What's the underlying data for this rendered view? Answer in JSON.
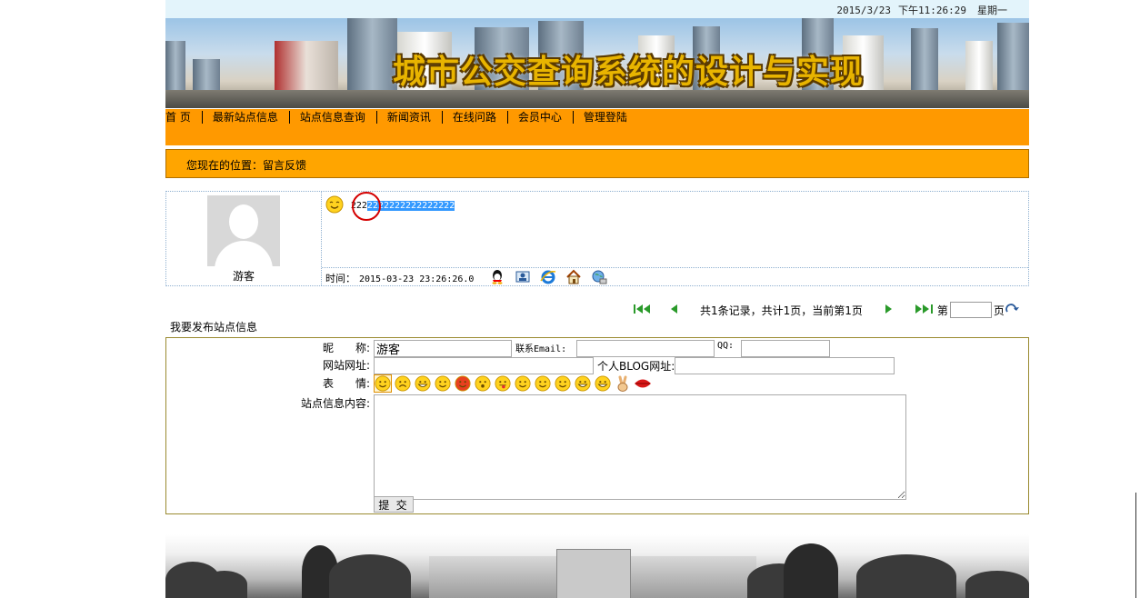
{
  "header": {
    "date": "2015/3/23",
    "time": "下午11:26:29",
    "weekday": "星期一",
    "banner_title": "城市公交查询系统的设计与实现"
  },
  "nav": {
    "items": [
      "首 页",
      "最新站点信息",
      "站点信息查询",
      "新闻资讯",
      "在线问路",
      "会员中心",
      "管理登陆"
    ]
  },
  "location": {
    "text": "您现在的位置：留言反馈"
  },
  "message": {
    "author": "游客",
    "text_plain": "222",
    "text_selected": "2222222222222222",
    "time_label": "时间：",
    "time_value": "2015-03-23 23:26:26.0",
    "icons": [
      "qq-icon",
      "profile-icon",
      "ie-icon",
      "home-icon",
      "globe-icon"
    ]
  },
  "pager": {
    "summary": "共1条记录，共计1页，当前第1页",
    "page_prefix": "第",
    "page_suffix": "页",
    "page_value": ""
  },
  "form": {
    "section_title": "我要发布站点信息",
    "nickname_label": "昵　　称:",
    "nickname_value": "游客",
    "email_label": "联系Email:",
    "email_value": "",
    "qq_label": "QQ:",
    "qq_value": "",
    "website_label": "网站网址:",
    "website_value": "",
    "blog_label": "个人BLOG网址:",
    "blog_value": "",
    "emoji_label": "表　　情:",
    "content_label": "站点信息内容:",
    "content_value": "",
    "submit_label": "提 交",
    "emoji_count": 14
  },
  "colors": {
    "nav_bg": "#ff9900",
    "location_bg": "#ffa500",
    "top_strip": "#e3f4fb",
    "selection": "#3399ff",
    "banner_text": "#e8b400"
  }
}
